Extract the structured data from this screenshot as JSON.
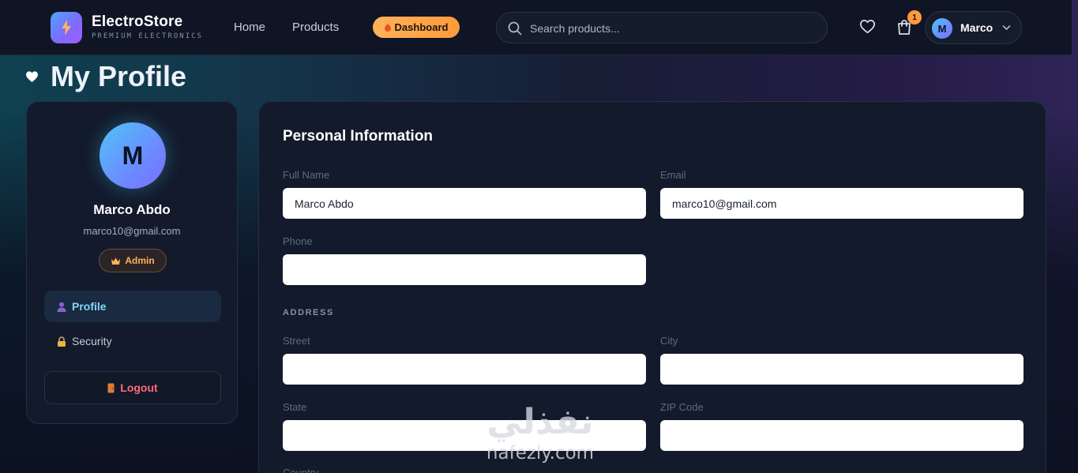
{
  "nav": {
    "brand_name": "ElectroStore",
    "brand_tagline": "PREMIUM ELECTRONICS",
    "links": [
      {
        "label": "Home"
      },
      {
        "label": "Products"
      }
    ],
    "dashboard_label": "Dashboard",
    "search_placeholder": "Search products...",
    "cart_count": "1",
    "user_initial": "M",
    "user_name": "Marco"
  },
  "page": {
    "title": "My Profile"
  },
  "sidebar": {
    "avatar_initial": "M",
    "name": "Marco Abdo",
    "email": "marco10@gmail.com",
    "role": "Admin",
    "items": [
      {
        "label": "Profile",
        "active": true
      },
      {
        "label": "Security",
        "active": false
      }
    ],
    "logout_label": "Logout"
  },
  "form": {
    "title": "Personal Information",
    "full_name": {
      "label": "Full Name",
      "value": "Marco Abdo"
    },
    "email": {
      "label": "Email",
      "value": "marco10@gmail.com"
    },
    "phone": {
      "label": "Phone",
      "value": ""
    },
    "address_section": "ADDRESS",
    "street": {
      "label": "Street",
      "value": ""
    },
    "city": {
      "label": "City",
      "value": ""
    },
    "state": {
      "label": "State",
      "value": ""
    },
    "zip": {
      "label": "ZIP Code",
      "value": ""
    },
    "country": {
      "label": "Country"
    }
  },
  "watermark": {
    "arabic": "نفذلي",
    "latin": "nafezly.com"
  },
  "colors": {
    "accent_orange": "#ff9a3c",
    "accent_cyan": "#4fc3f7",
    "logout_red": "#ff6b7a",
    "panel_bg": "#121a2b"
  }
}
